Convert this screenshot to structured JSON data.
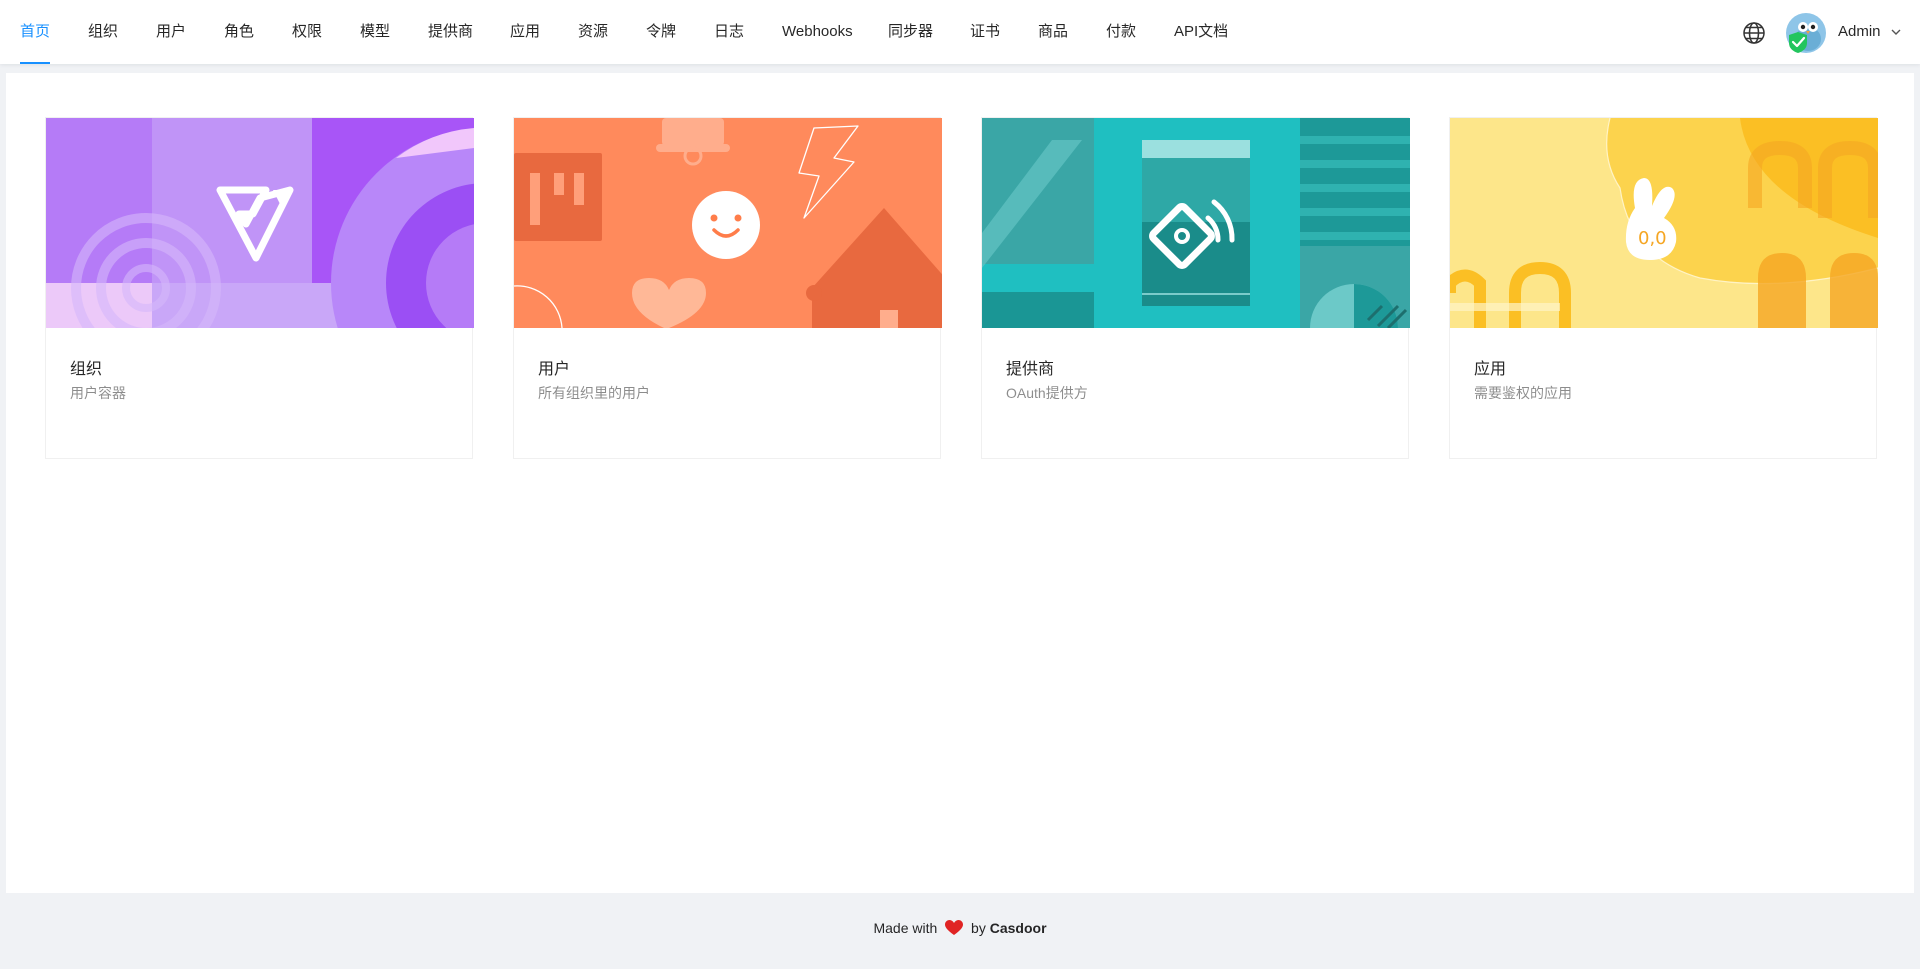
{
  "nav": {
    "items": [
      {
        "label": "首页",
        "active": true
      },
      {
        "label": "组织"
      },
      {
        "label": "用户"
      },
      {
        "label": "角色"
      },
      {
        "label": "权限"
      },
      {
        "label": "模型"
      },
      {
        "label": "提供商"
      },
      {
        "label": "应用"
      },
      {
        "label": "资源"
      },
      {
        "label": "令牌"
      },
      {
        "label": "日志"
      },
      {
        "label": "Webhooks"
      },
      {
        "label": "同步器"
      },
      {
        "label": "证书"
      },
      {
        "label": "商品"
      },
      {
        "label": "付款"
      },
      {
        "label": "API文档"
      }
    ],
    "language_icon": "globe-icon",
    "user": {
      "name": "Admin"
    }
  },
  "cards": [
    {
      "title": "组织",
      "description": "用户容器",
      "cover_color": "#a855f7"
    },
    {
      "title": "用户",
      "description": "所有组织里的用户",
      "cover_color": "#ff8a5c"
    },
    {
      "title": "提供商",
      "description": "OAuth提供方",
      "cover_color": "#1fbfc1"
    },
    {
      "title": "应用",
      "description": "需要鉴权的应用",
      "cover_color": "#fcd34d"
    }
  ],
  "footer": {
    "prefix": "Made with",
    "by": "by",
    "brand": "Casdoor"
  },
  "colors": {
    "accent": "#1890ff",
    "heart": "#e02424"
  }
}
